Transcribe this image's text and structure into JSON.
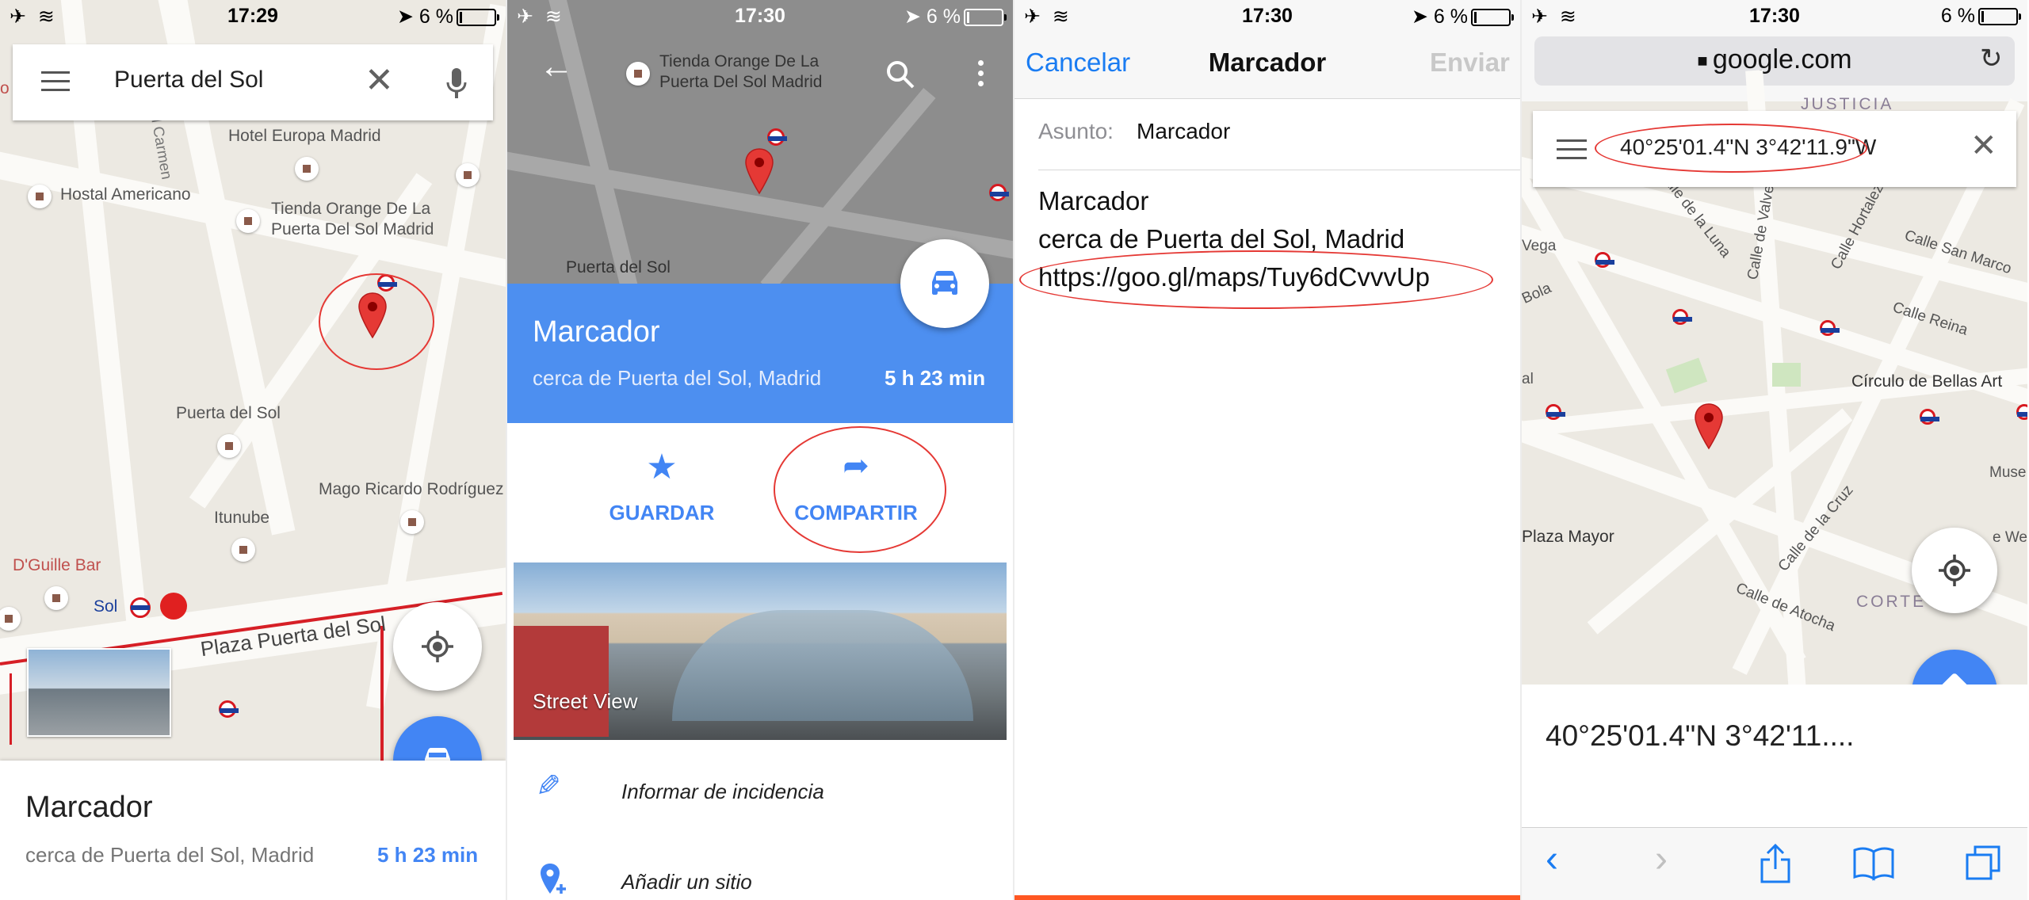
{
  "panel1": {
    "status": {
      "time": "17:29",
      "battery": "6 %"
    },
    "search": {
      "value": "Puerta del Sol"
    },
    "map": {
      "labels": {
        "hotel_europa": "Hotel Europa Madrid",
        "hostal": "Hostal Americano",
        "tienda_line1": "Tienda Orange De La",
        "tienda_line2": "Puerta Del Sol Madrid",
        "puerta": "Puerta del Sol",
        "mago": "Mago Ricardo Rodríguez",
        "itunube": "Itunube",
        "dguille": "D'Guille Bar",
        "sol": "Sol",
        "plaza": "Plaza Puerta del Sol",
        "street_left": "Calle del Carmen",
        "cut_letter": "o"
      }
    },
    "card": {
      "title": "Marcador",
      "subtitle": "cerca de Puerta del Sol, Madrid",
      "eta": "5 h 23 min"
    }
  },
  "panel2": {
    "status": {
      "time": "17:30",
      "battery": "6 %"
    },
    "map": {
      "tienda_line1": "Tienda Orange De La",
      "tienda_line2": "Puerta Del Sol Madrid",
      "puerta": "Puerta del Sol"
    },
    "header": {
      "title": "Marcador",
      "subtitle": "cerca de Puerta del Sol, Madrid",
      "eta": "5 h 23 min"
    },
    "actions": {
      "save": "GUARDAR",
      "share": "COMPARTIR"
    },
    "street_view": "Street View",
    "menu": {
      "report": "Informar de incidencia",
      "add_place": "Añadir un sitio"
    }
  },
  "panel3": {
    "status": {
      "time": "17:30",
      "battery": "6 %"
    },
    "nav": {
      "cancel": "Cancelar",
      "title": "Marcador",
      "send": "Enviar"
    },
    "subject_label": "Asunto:",
    "subject_value": "Marcador",
    "body": {
      "line1": "Marcador",
      "line2": "cerca de Puerta del Sol, Madrid",
      "link": "https://goo.gl/maps/Tuy6dCvvvUp"
    }
  },
  "panel4": {
    "status": {
      "time": "17:30",
      "battery": "6 %"
    },
    "url": "google.com",
    "search": {
      "value": "40°25'01.4\"N 3°42'11.9\"W"
    },
    "map": {
      "labels": {
        "justicia": "JUSTICIA",
        "luna": "Calle de la Luna",
        "valverde": "Calle de Valverde",
        "hortaleza": "Calle Hortaleza",
        "san_marcos": "Calle San Marco",
        "vega": "Vega",
        "bola": "Bola",
        "reina": "Calle Reina",
        "bellas_artes": "Círculo de Bellas Art",
        "al": "al",
        "musee": "Muse",
        "plaza_mayor": "Plaza Mayor",
        "cruz": "Calle de la Cruz",
        "we": "e We",
        "corte": "CORTE",
        "atocha": "Calle de Atocha"
      }
    },
    "result": "40°25'01.4\"N 3°42'11...."
  }
}
